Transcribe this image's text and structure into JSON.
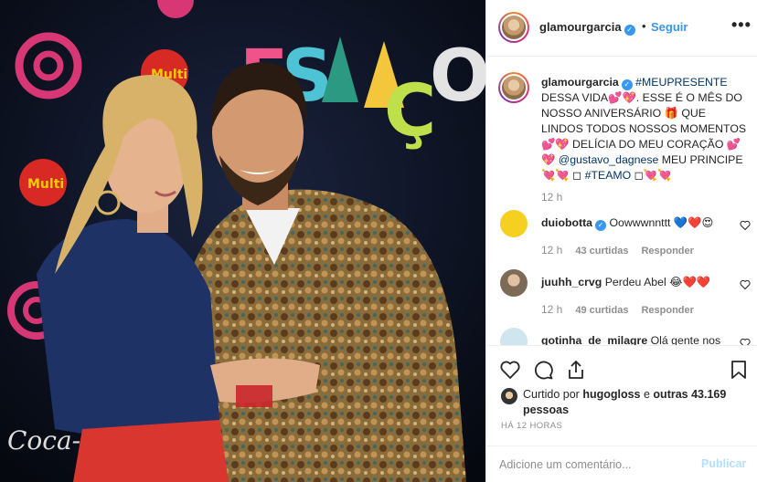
{
  "post": {
    "author": "glamourgarcia",
    "follow_label": "Seguir",
    "dot": "•",
    "more": "•••"
  },
  "caption": {
    "username": "glamourgarcia",
    "hashtag": "#MEUPRESENTE",
    "line1": " DESSA VIDA💕💖. ESSE É O MÊS DO NOSSO ANIVERSÁRIO 🎁 QUE LINDOS TODOS NOSSOS MOMENTOS💕💖 DELÍCIA DO MEU CORAÇÃO 💕💖 ",
    "mention": "@gustavo_dagnese",
    "line2": " MEU PRINCIPE💘💘 ◻ ",
    "hashtag2": "#TEAMO",
    "line3": " ◻💘💘",
    "time": "12 h"
  },
  "comments": [
    {
      "username": "duiobotta",
      "verified": true,
      "text": "Oowwwnnttt 💙❤️😍",
      "time": "12 h",
      "likes": "43 curtidas",
      "reply": "Responder",
      "avatar_color": "#f5d020"
    },
    {
      "username": "juuhh_crvg",
      "verified": false,
      "text": "Perdeu Abel 😂❤️❤️",
      "time": "12 h",
      "likes": "49 curtidas",
      "reply": "Responder",
      "avatar_color": "#b9a48c"
    },
    {
      "username": "gotinha_de_milagre",
      "verified": false,
      "text": "Olá gente nos",
      "time": "",
      "likes": "",
      "reply": "",
      "avatar_color": "#7fb6c9"
    }
  ],
  "likes": {
    "prefix": "Curtido por ",
    "by": "hugogloss",
    "middle": " e ",
    "others": "outras 43.169 pessoas"
  },
  "posted_ago": "HÁ 12 HORAS",
  "add_comment": {
    "placeholder": "Adicione um comentário...",
    "publish": "Publicar"
  },
  "colors": {
    "accent": "#3897f0",
    "link": "#003569",
    "muted": "#8e8e8e",
    "publish_disabled": "#b2dffc"
  },
  "photo": {
    "backdrop_text": "ESTAÇÃO",
    "brand_text": "Coca-Cola"
  }
}
